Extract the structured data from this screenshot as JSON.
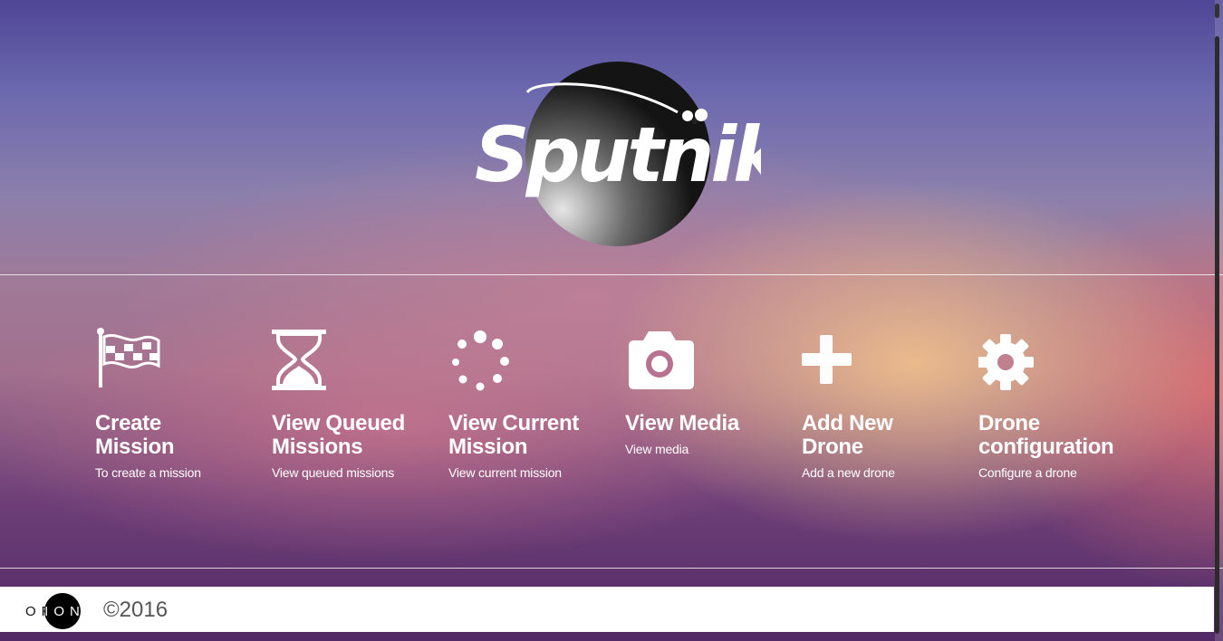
{
  "brand": {
    "logo_text": "Sputnik"
  },
  "tiles": [
    {
      "icon": "flag-icon",
      "title_line1": "Create",
      "title_line2": "Mission",
      "desc": "To create a mission"
    },
    {
      "icon": "hourglass-icon",
      "title_line1": "View Queued",
      "title_line2": "Missions",
      "desc": "View queued missions"
    },
    {
      "icon": "spinner-icon",
      "title_line1": "View Current",
      "title_line2": "Mission",
      "desc": "View current mission"
    },
    {
      "icon": "camera-icon",
      "title_line1": "View Media",
      "title_line2": "",
      "desc": "View media"
    },
    {
      "icon": "plus-icon",
      "title_line1": "Add New",
      "title_line2": "Drone",
      "desc": "Add a new drone"
    },
    {
      "icon": "gear-icon",
      "title_line1": "Drone",
      "title_line2": "configuration",
      "desc": "Configure a drone"
    }
  ],
  "footer": {
    "org_logo_left": "OR",
    "org_logo_right": "ION",
    "copyright": "©2016"
  },
  "colors": {
    "tile_text": "#ffffff",
    "footer_bg": "#ffffff",
    "copyright": "#555555"
  }
}
